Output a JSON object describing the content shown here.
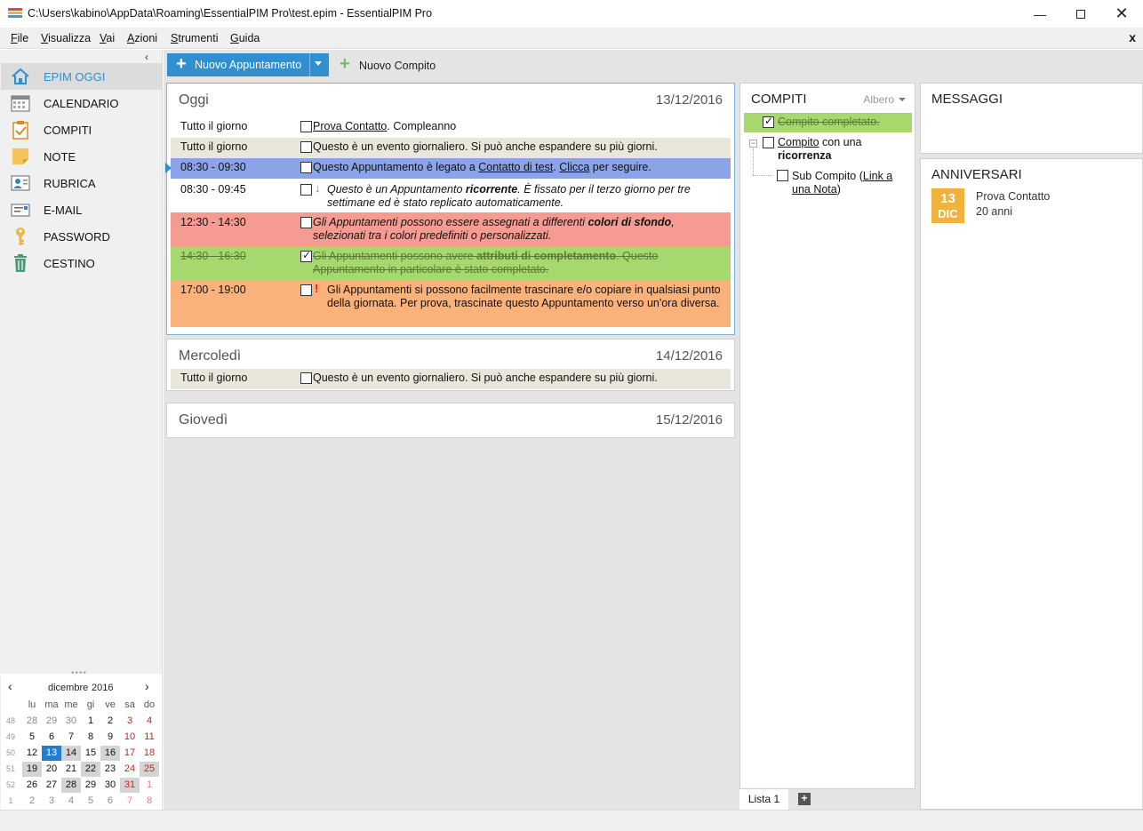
{
  "window": {
    "title": "C:\\Users\\kabino\\AppData\\Roaming\\EssentialPIM Pro\\test.epim - EssentialPIM Pro",
    "controls": [
      "minimize-icon",
      "maximize-icon",
      "close-icon"
    ]
  },
  "menu": {
    "items": [
      "File",
      "Visualizza",
      "Vai",
      "Azioni",
      "Strumenti",
      "Guida"
    ],
    "close": "x"
  },
  "sidebar": {
    "items": [
      {
        "label": "EPIM OGGI",
        "icon": "home-icon",
        "active": true
      },
      {
        "label": "CALENDARIO",
        "icon": "calendar-icon"
      },
      {
        "label": "COMPITI",
        "icon": "tasks-icon"
      },
      {
        "label": "NOTE",
        "icon": "note-icon"
      },
      {
        "label": "RUBRICA",
        "icon": "contacts-icon"
      },
      {
        "label": "E-MAIL",
        "icon": "mail-icon"
      },
      {
        "label": "PASSWORD",
        "icon": "key-icon"
      },
      {
        "label": "CESTINO",
        "icon": "trash-icon"
      }
    ]
  },
  "minical": {
    "month": "dicembre",
    "year": "2016",
    "dow": [
      "lu",
      "ma",
      "me",
      "gi",
      "ve",
      "sa",
      "do"
    ],
    "weeks": [
      {
        "wk": "48",
        "days": [
          "28",
          "29",
          "30",
          "1",
          "2",
          "3",
          "4"
        ]
      },
      {
        "wk": "49",
        "days": [
          "5",
          "6",
          "7",
          "8",
          "9",
          "10",
          "11"
        ]
      },
      {
        "wk": "50",
        "days": [
          "12",
          "13",
          "14",
          "15",
          "16",
          "17",
          "18"
        ]
      },
      {
        "wk": "51",
        "days": [
          "19",
          "20",
          "21",
          "22",
          "23",
          "24",
          "25"
        ]
      },
      {
        "wk": "52",
        "days": [
          "26",
          "27",
          "28",
          "29",
          "30",
          "31",
          "1"
        ]
      },
      {
        "wk": "1",
        "days": [
          "2",
          "3",
          "4",
          "5",
          "6",
          "7",
          "8"
        ]
      }
    ],
    "today": "13",
    "accent": "#1f7fce"
  },
  "toolbar": {
    "new_appt": "Nuovo Appuntamento",
    "new_task": "Nuovo Compito"
  },
  "today": {
    "name": "Oggi",
    "date": "13/12/2016",
    "time_allday1": "Tutto il giorno",
    "e1_link": "Prova Contatto",
    "e1_rest": ". Compleanno",
    "time_allday2": "Tutto il giorno",
    "e2": "Questo è un evento giornaliero. Si può anche espandere su più giorni.",
    "time3": "08:30 - 09:30",
    "e3_a": "Questo Appuntamento è legato a ",
    "e3_link1": "Contatto di test",
    "e3_b": ". ",
    "e3_link2": "Clicca",
    "e3_c": " per seguire.",
    "time4": "08:30 - 09:45",
    "e4_ind": "↓",
    "e4_a": "Questo è un Appuntamento ",
    "e4_b": "ricorrente",
    "e4_c": ". È fissato per il terzo giorno per tre settimane ed è stato replicato automaticamente.",
    "time5": "12:30 - 14:30",
    "e5_a": "Gli Appuntamenti possono essere assegnati a differenti ",
    "e5_b": "colori di sfondo",
    "e5_c": ", selezionati tra i colori predefiniti o personalizzati.",
    "time6": "14:30 - 16:30",
    "e6_a": "Gli Appuntamenti possono avere ",
    "e6_b": "attributi di completamento",
    "e6_c": ". Questo Appuntamento in particolare è stato completato.",
    "time7": "17:00 - 19:00",
    "e7_ind": "!",
    "e7": "Gli Appuntamenti si possono facilmente trascinare e/o copiare in qualsiasi punto della giornata. Per prova, trascinate questo Appuntamento verso un'ora diversa.",
    "colors": {
      "allday": "#e9e6da",
      "blue": "#8aa4e6",
      "red": "#f59b92",
      "green": "#a6d86d",
      "orange": "#fbb27a"
    }
  },
  "wed": {
    "name": "Mercoledì",
    "date": "14/12/2016",
    "time": "Tutto il giorno",
    "text": "Questo è un evento giornaliero. Si può anche espandere su più giorni."
  },
  "thu": {
    "name": "Giovedì",
    "date": "15/12/2016"
  },
  "tasks": {
    "title": "COMPITI",
    "view": "Albero",
    "t1": "Compito completato.",
    "t2_link": "Compito",
    "t2_a": " con una",
    "t2_b": "ricorrenza",
    "t3_a": "Sub Compito (",
    "t3_link1": "Link a",
    "t3_link2": "una Nota",
    "t3_close": ")",
    "tab": "Lista 1",
    "add": "+"
  },
  "messages": {
    "title": "MESSAGGI"
  },
  "anniversaries": {
    "title": "ANNIVERSARI",
    "day": "13",
    "month": "DIC",
    "name": "Prova Contatto",
    "years": "20 anni"
  }
}
